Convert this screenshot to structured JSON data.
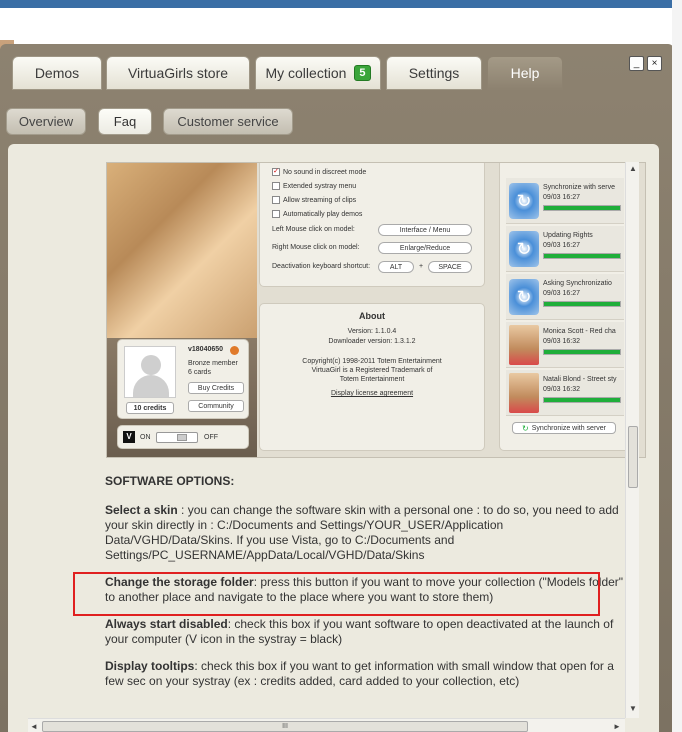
{
  "tabs": [
    {
      "label": "Demos"
    },
    {
      "label": "VirtuaGirls store"
    },
    {
      "label": "My collection",
      "badge": "5"
    },
    {
      "label": "Settings"
    },
    {
      "label": "Help"
    }
  ],
  "window_controls": {
    "minimize": "_",
    "close": "×"
  },
  "subtabs": [
    {
      "label": "Overview"
    },
    {
      "label": "Faq"
    },
    {
      "label": "Customer service"
    }
  ],
  "inner_screenshot": {
    "options": [
      {
        "label": "No sound in discreet mode",
        "checked": true
      },
      {
        "label": "Extended systray menu",
        "checked": false
      },
      {
        "label": "Allow streaming of clips",
        "checked": false
      },
      {
        "label": "Automatically play demos",
        "checked": false
      }
    ],
    "left_click_label": "Left Mouse click on model:",
    "left_click_value": "Interface / Menu",
    "right_click_label": "Right Mouse click on model:",
    "right_click_value": "Enlarge/Reduce",
    "shortcut_label": "Deactivation keyboard shortcut:",
    "shortcut_key1": "ALT",
    "shortcut_plus": "+",
    "shortcut_key2": "SPACE",
    "about": {
      "title": "About",
      "version": "Version: 1.1.0.4",
      "downloader": "Downloader version: 1.3.1.2",
      "copyright": "Copyright(c) 1998-2011 Totem Entertainment",
      "trademark": "VirtuaGirl is a Registered Trademark of",
      "company": "Totem Entertainment",
      "license_link": "Display license agreement"
    },
    "profile": {
      "username": "v18040650",
      "member": "Bronze member",
      "cards": "6 cards",
      "credits": "10 credits",
      "buy_credits": "Buy Credits",
      "community": "Community"
    },
    "toggle": {
      "on": "ON",
      "off": "OFF",
      "logo": "V"
    },
    "sync_items": [
      {
        "title": "Synchronize with serve",
        "date": "09/03 16:27",
        "kind": "sync",
        "progress": 1.0
      },
      {
        "title": "Updating Rights",
        "date": "09/03 16:27",
        "kind": "sync",
        "progress": 1.0
      },
      {
        "title": "Asking Synchronizatio",
        "date": "09/03 16:27",
        "kind": "sync",
        "progress": 1.0
      },
      {
        "title": "Monica Scott - Red cha",
        "date": "09/03 16:32",
        "kind": "model",
        "progress": 1.0
      },
      {
        "title": "Natali Blond - Street sty",
        "date": "09/03 16:32",
        "kind": "model",
        "progress": 1.0
      }
    ],
    "sync_button": "Synchronize with server"
  },
  "help": {
    "section_title": "SOFTWARE OPTIONS:",
    "paragraphs": [
      {
        "title": "Select a skin",
        "text": " : you can change the software skin with a personal one : to do so, you need to add your skin directly in : C:/Documents and Settings/YOUR_USER/Application Data/VGHD/Data/Skins. If you use Vista, go to C:/Documents and Settings/PC_USERNAME/AppData/Local/VGHD/Data/Skins"
      },
      {
        "title": "Change the storage folder",
        "text": ": press this button if you want to move your collection (\"Models folder\" to another place and navigate to the place where you want to store them)"
      },
      {
        "title": "Always start disabled",
        "text": ": check this box if you want software to open deactivated at the launch of your computer (V icon in the systray = black)"
      },
      {
        "title": "Display tooltips",
        "text": ": check this box if you want to get information with small window that open for a few sec on your systray (ex : credits added, card added to your collection, etc)"
      }
    ]
  },
  "scroll": {
    "h_thumb_grip": "III",
    "up": "▲",
    "down": "▼",
    "left": "◄",
    "right": "►",
    "grip": "◢"
  }
}
